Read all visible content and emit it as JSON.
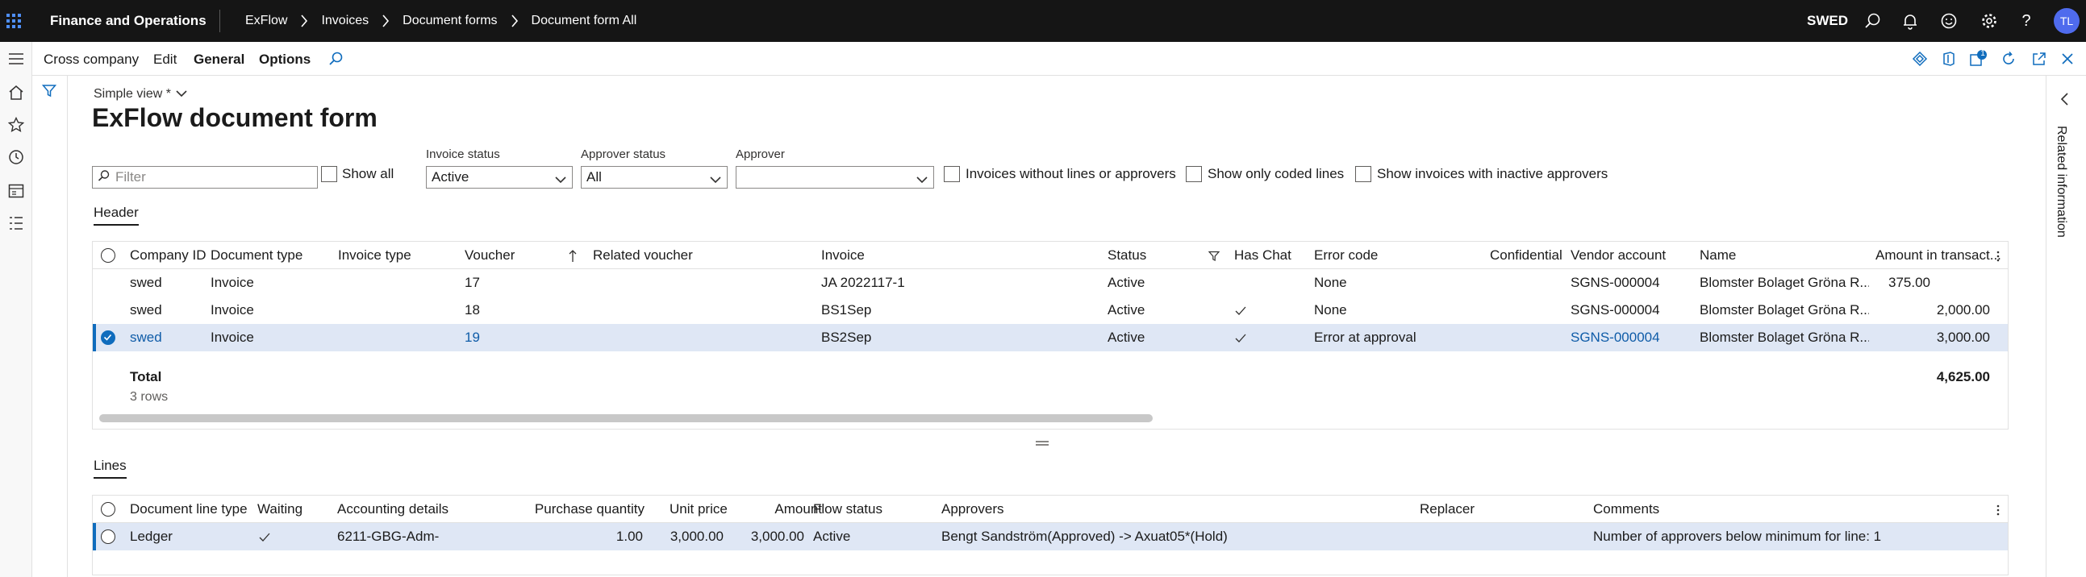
{
  "topbar": {
    "app_title": "Finance and Operations",
    "breadcrumbs": [
      "ExFlow",
      "Invoices",
      "Document forms",
      "Document form All"
    ],
    "company": "SWED",
    "avatar_initials": "TL"
  },
  "actionpane": {
    "items": [
      "Cross company",
      "Edit",
      "General",
      "Options"
    ],
    "notification_badge": "1"
  },
  "page": {
    "view_selector": "Simple view *",
    "title": "ExFlow document form",
    "filter_placeholder": "Filter",
    "show_all_label": "Show all",
    "invoice_status_label": "Invoice status",
    "invoice_status_value": "Active",
    "approver_status_label": "Approver status",
    "approver_status_value": "All",
    "approver_label": "Approver",
    "approver_value": "",
    "cb_without_lines": "Invoices without lines or approvers",
    "cb_only_coded": "Show only coded lines",
    "cb_inactive_approvers": "Show invoices with inactive approvers",
    "related_information": "Related information"
  },
  "header_grid": {
    "tab_label": "Header",
    "columns": [
      "Company ID",
      "Document type",
      "Invoice type",
      "Voucher",
      "Related voucher",
      "Invoice",
      "Status",
      "Has Chat",
      "Error code",
      "Confidential",
      "Vendor account",
      "Name",
      "Amount in transact..."
    ],
    "rows": [
      {
        "company": "swed",
        "doc_type": "Invoice",
        "voucher": "17",
        "invoice": "JA 2022117-1",
        "status": "Active",
        "has_chat": false,
        "error": "None",
        "vendor": "SGNS-000004",
        "name": "Blomster Bolaget Gröna R...",
        "amount": "375.00"
      },
      {
        "company": "swed",
        "doc_type": "Invoice",
        "voucher": "18",
        "invoice": "BS1Sep",
        "status": "Active",
        "has_chat": true,
        "error": "None",
        "vendor": "SGNS-000004",
        "name": "Blomster Bolaget Gröna R...",
        "amount": "2,000.00"
      },
      {
        "company": "swed",
        "doc_type": "Invoice",
        "voucher": "19",
        "invoice": "BS2Sep",
        "status": "Active",
        "has_chat": true,
        "error": "Error at approval",
        "vendor": "SGNS-000004",
        "name": "Blomster Bolaget Gröna R...",
        "amount": "3,000.00"
      }
    ],
    "total_label": "Total",
    "total_rows": "3 rows",
    "total_amount": "4,625.00"
  },
  "lines_grid": {
    "tab_label": "Lines",
    "columns": [
      "Document line type",
      "Waiting",
      "Accounting details",
      "Purchase quantity",
      "Unit price",
      "Amount",
      "Flow status",
      "Approvers",
      "Replacer",
      "Comments"
    ],
    "rows": [
      {
        "line_type": "Ledger",
        "waiting": true,
        "accounting": "6211-GBG-Adm-",
        "qty": "1.00",
        "unit_price": "3,000.00",
        "amount": "3,000.00",
        "flow_status": "Active",
        "approvers": "Bengt Sandström(Approved) -> Axuat05*(Hold)",
        "replacer": "",
        "comments": "Number of approvers below minimum for line: 1"
      }
    ]
  },
  "colors": {
    "topbar_bg": "#151515",
    "accent": "#0f6cbd",
    "selected_row": "#dfe7f5",
    "avatar_bg": "#4f6bed"
  }
}
